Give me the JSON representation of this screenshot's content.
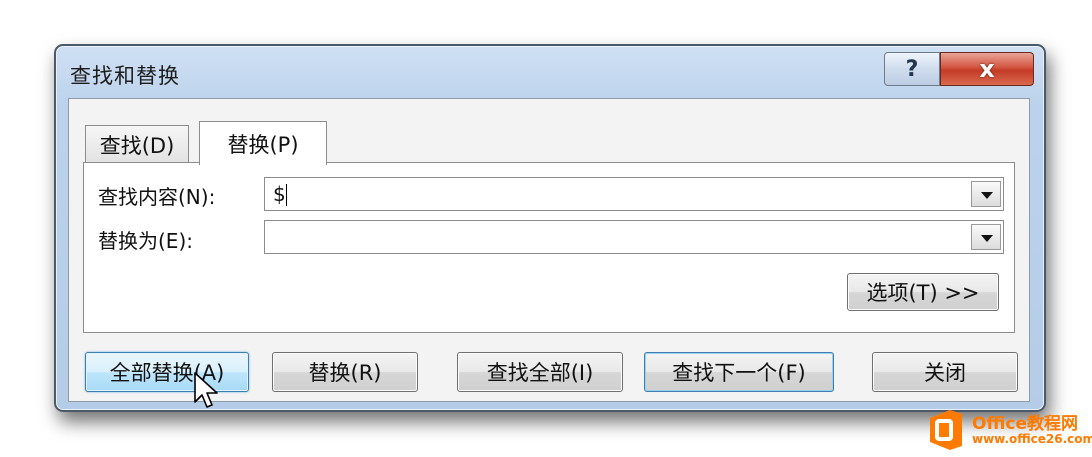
{
  "window": {
    "title": "查找和替换",
    "help_label": "?",
    "close_label": "x"
  },
  "tabs": [
    {
      "label": "查找(D)",
      "active": false
    },
    {
      "label": "替换(P)",
      "active": true
    }
  ],
  "form": {
    "find_label": "查找内容(N):",
    "find_value": "$",
    "replace_label": "替换为(E):",
    "replace_value": "",
    "options_label": "选项(T) >>"
  },
  "buttons": {
    "replace_all": "全部替换(A)",
    "replace": "替换(R)",
    "find_all": "查找全部(I)",
    "find_next": "查找下一个(F)",
    "close": "关闭"
  },
  "watermark": {
    "name": "Office教程网",
    "url": "www.office26.com"
  },
  "colors": {
    "close_button": "#c43b26",
    "hot_button": "#a7d9f5",
    "window_frame": "#bcd2ec",
    "watermark": "#ff7a00"
  }
}
